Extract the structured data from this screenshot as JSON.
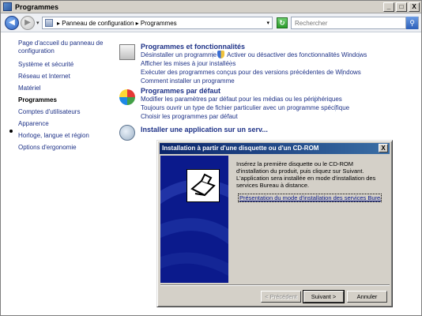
{
  "window": {
    "title": "Programmes",
    "minimize": "_",
    "maximize": "□",
    "close": "X"
  },
  "address": {
    "crumbs": "▸ Panneau de configuration ▸ Programmes",
    "dropdown": "▾",
    "search_placeholder": "Rechercher"
  },
  "sidebar": {
    "items": [
      "Page d'accueil du panneau de configuration",
      "Système et sécurité",
      "Réseau et Internet",
      "Matériel",
      "Programmes",
      "Comptes d'utilisateurs",
      "Apparence",
      "Horloge, langue et région",
      "Options d'ergonomie"
    ]
  },
  "sections": {
    "programs_features": {
      "title": "Programmes et fonctionnalités",
      "links": [
        "Désinstaller un programme",
        "Activer ou désactiver des fonctionnalités Windows",
        "Afficher les mises à jour installées",
        "Exécuter des programmes conçus pour des versions précédentes de Windows",
        "Comment installer un programme"
      ]
    },
    "default_programs": {
      "title": "Programmes par défaut",
      "links": [
        "Modifier les paramètres par défaut pour les médias ou les périphériques",
        "Toujours ouvrir un type de fichier particulier avec un programme spécifique",
        "Choisir les programmes par défaut"
      ]
    },
    "install_app": {
      "title": "Installer une application sur un serv..."
    }
  },
  "dialog": {
    "title": "Installation à partir d'une disquette ou d'un CD-ROM",
    "close": "X",
    "body": "Insérez la première disquette ou le CD-ROM d'installation du produit, puis cliquez sur Suivant. L'application sera installée en mode d'installation des services Bureau à distance.",
    "link": "Présentation du mode d'installation des services Bureau à",
    "buttons": {
      "back": "< Précédent",
      "next": "Suivant >",
      "cancel": "Annuler"
    }
  }
}
